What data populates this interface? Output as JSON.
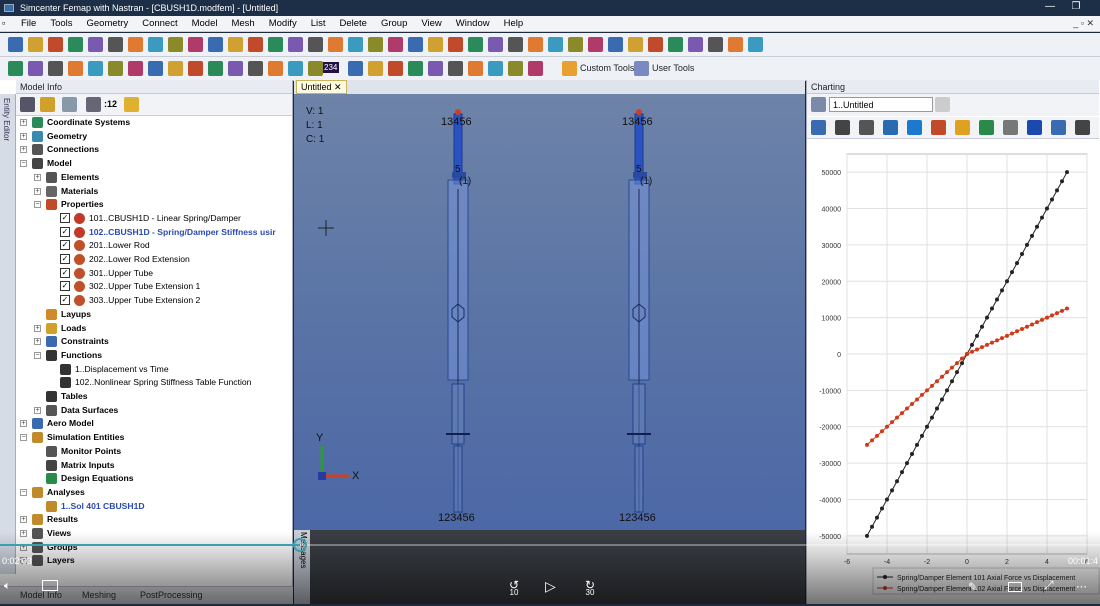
{
  "window": {
    "title": "Simcenter Femap with Nastran - [CBUSH1D.modfem] - [Untitled]",
    "min": "—",
    "max": "❐"
  },
  "menu": [
    "File",
    "Tools",
    "Geometry",
    "Connect",
    "Model",
    "Mesh",
    "Modify",
    "List",
    "Delete",
    "Group",
    "View",
    "Window",
    "Help"
  ],
  "toolbar": {
    "custom_tools": "Custom Tools",
    "user_tools": "User Tools",
    "count": "234"
  },
  "model_info": {
    "header": "Model Info",
    "side_tab": "Entity Editor",
    "toolbar_label": ":12",
    "tree": [
      {
        "label": "Coordinate Systems",
        "level": 0,
        "bold": true,
        "exp": "+",
        "icon": "#2a8a5a"
      },
      {
        "label": "Geometry",
        "level": 0,
        "bold": true,
        "exp": "+",
        "icon": "#3a8ab0"
      },
      {
        "label": "Connections",
        "level": 0,
        "bold": true,
        "exp": "+",
        "icon": "#555"
      },
      {
        "label": "Model",
        "level": 0,
        "bold": true,
        "exp": "−",
        "icon": "#444"
      },
      {
        "label": "Elements",
        "level": 1,
        "bold": true,
        "exp": "+",
        "icon": "#555"
      },
      {
        "label": "Materials",
        "level": 1,
        "bold": true,
        "exp": "+",
        "icon": "#666"
      },
      {
        "label": "Properties",
        "level": 1,
        "bold": true,
        "exp": "−",
        "icon": "#c04a2a"
      },
      {
        "label": "101..CBUSH1D - Linear Spring/Damper",
        "level": 2,
        "check": true,
        "icon": "#c03a2a"
      },
      {
        "label": "102..CBUSH1D - Spring/Damper Stiffness usir",
        "level": 2,
        "check": true,
        "icon": "#c03a2a",
        "highlight": true
      },
      {
        "label": "201..Lower Rod",
        "level": 2,
        "check": true,
        "icon": "#c0502a"
      },
      {
        "label": "202..Lower Rod Extension",
        "level": 2,
        "check": true,
        "icon": "#c0502a"
      },
      {
        "label": "301..Upper Tube",
        "level": 2,
        "check": true,
        "icon": "#c0502a"
      },
      {
        "label": "302..Upper Tube Extension 1",
        "level": 2,
        "check": true,
        "icon": "#c0502a"
      },
      {
        "label": "303..Upper Tube Extension 2",
        "level": 2,
        "check": true,
        "icon": "#c0502a"
      },
      {
        "label": "Layups",
        "level": 1,
        "bold": true,
        "icon": "#d08a2a"
      },
      {
        "label": "Loads",
        "level": 1,
        "bold": true,
        "exp": "+",
        "icon": "#d0a02a"
      },
      {
        "label": "Constraints",
        "level": 1,
        "bold": true,
        "exp": "+",
        "icon": "#3a6ab0"
      },
      {
        "label": "Functions",
        "level": 1,
        "bold": true,
        "exp": "−",
        "icon": "#333"
      },
      {
        "label": "1..Displacement vs Time",
        "level": 2,
        "icon": "#333"
      },
      {
        "label": "102..Nonlinear Spring Stiffness Table Function",
        "level": 2,
        "icon": "#333"
      },
      {
        "label": "Tables",
        "level": 1,
        "bold": true,
        "icon": "#333"
      },
      {
        "label": "Data Surfaces",
        "level": 1,
        "bold": true,
        "exp": "+",
        "icon": "#555"
      },
      {
        "label": "Aero Model",
        "level": 0,
        "bold": true,
        "exp": "+",
        "icon": "#3a6ab0"
      },
      {
        "label": "Simulation Entities",
        "level": 0,
        "bold": true,
        "exp": "−",
        "icon": "#c08a2a"
      },
      {
        "label": "Monitor Points",
        "level": 1,
        "bold": true,
        "icon": "#555"
      },
      {
        "label": "Matrix Inputs",
        "level": 1,
        "bold": true,
        "icon": "#444"
      },
      {
        "label": "Design Equations",
        "level": 1,
        "bold": true,
        "icon": "#2a8a4a"
      },
      {
        "label": "Analyses",
        "level": 0,
        "bold": true,
        "exp": "−",
        "icon": "#c08a2a"
      },
      {
        "label": "1..Sol 401 CBUSH1D",
        "level": 1,
        "bold": true,
        "icon": "#c08a2a",
        "blue": true
      },
      {
        "label": "Results",
        "level": 0,
        "bold": true,
        "exp": "+",
        "icon": "#c08a2a"
      },
      {
        "label": "Views",
        "level": 0,
        "bold": true,
        "exp": "+",
        "icon": "#555"
      },
      {
        "label": "Groups",
        "level": 0,
        "bold": true,
        "exp": "+",
        "icon": "#555"
      },
      {
        "label": "Layers",
        "level": 0,
        "bold": true,
        "exp": "+",
        "icon": "#555"
      }
    ],
    "bottom_tabs": [
      "Model Info",
      "Meshing",
      "PostProcessing"
    ]
  },
  "view": {
    "tab": "Untitled",
    "info": [
      "V: 1",
      "L: 1",
      "C: 1"
    ],
    "node_top": "13456",
    "node_bottom": "123456",
    "elem_label": "5",
    "elem_id": "(1)",
    "axis_y": "Y",
    "axis_x": "X",
    "msg_tab": "Messages"
  },
  "charting": {
    "header": "Charting",
    "chart_name": "1..Untitled"
  },
  "chart_data": {
    "type": "line",
    "x": [
      -5,
      -4.5,
      -4,
      -3.5,
      -3,
      -2.5,
      -2,
      -1.5,
      -1,
      -0.5,
      0,
      0.5,
      1,
      1.5,
      2,
      2.5,
      3,
      3.5,
      4,
      4.5,
      5
    ],
    "series": [
      {
        "name": "Spring/Damper Element 101 Axial Force vs Displacement",
        "color": "#222222",
        "values": [
          -50000,
          -45000,
          -40000,
          -35000,
          -30000,
          -25000,
          -20000,
          -15000,
          -10000,
          -5000,
          0,
          5000,
          10000,
          15000,
          20000,
          25000,
          30000,
          35000,
          40000,
          45000,
          50000
        ]
      },
      {
        "name": "Spring/Damper Element 102 Axial Force vs Displacement",
        "color": "#d03a1a",
        "values": [
          -25000,
          -22500,
          -20000,
          -17500,
          -15000,
          -12500,
          -10000,
          -7500,
          -5000,
          -2500,
          0,
          1250,
          2500,
          3750,
          5000,
          6250,
          7500,
          8750,
          10000,
          11250,
          12500
        ]
      }
    ],
    "xticks": [
      "-6",
      "-4",
      "-2",
      "0",
      "2",
      "4",
      "6"
    ],
    "yticks": [
      "50000",
      "40000",
      "30000",
      "20000",
      "10000",
      "0",
      "-10000",
      "-20000",
      "-30000",
      "-40000",
      "-50000"
    ],
    "xlim": [
      -6,
      6
    ],
    "ylim": [
      -55000,
      55000
    ],
    "grid": true,
    "legend": "bottom-right"
  },
  "video": {
    "time_left": "0:02:03",
    "time_right": "00:01:4",
    "skip_back": "10",
    "skip_fwd": "30",
    "progress": 0.5
  }
}
